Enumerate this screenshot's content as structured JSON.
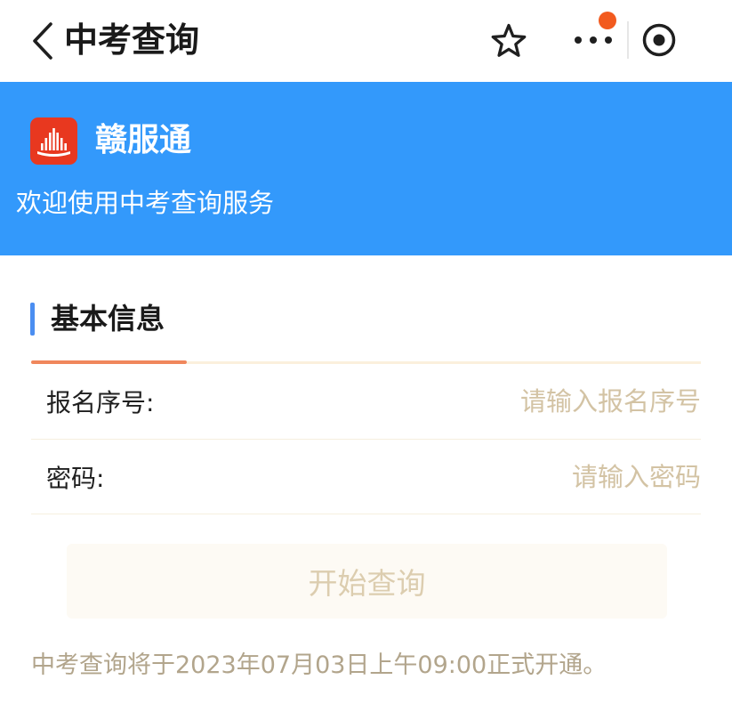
{
  "nav": {
    "title": "中考查询"
  },
  "banner": {
    "app_name": "赣服通",
    "welcome": "欢迎使用中考查询服务"
  },
  "form": {
    "section_title": "基本信息",
    "fields": [
      {
        "label": "报名序号:",
        "placeholder": "请输入报名序号"
      },
      {
        "label": "密码:",
        "placeholder": "请输入密码"
      }
    ],
    "submit_label": "开始查询"
  },
  "notice": "中考查询将于2023年07月03日上午09:00正式开通。",
  "icons": {
    "back": "chevron-left-icon",
    "favorite": "star-icon",
    "more": "more-dots-icon",
    "exit": "circle-dot-icon",
    "logo": "app-logo-icon"
  },
  "colors": {
    "banner": "#3399fb",
    "logo": "#e8381f",
    "badge": "#f25a1e",
    "section_accent": "#4b8ef1",
    "tab_indicator": "#f0875c",
    "placeholder": "#d3c3a4",
    "button_text": "#dccdaf",
    "notice_text": "#b2a58c"
  }
}
